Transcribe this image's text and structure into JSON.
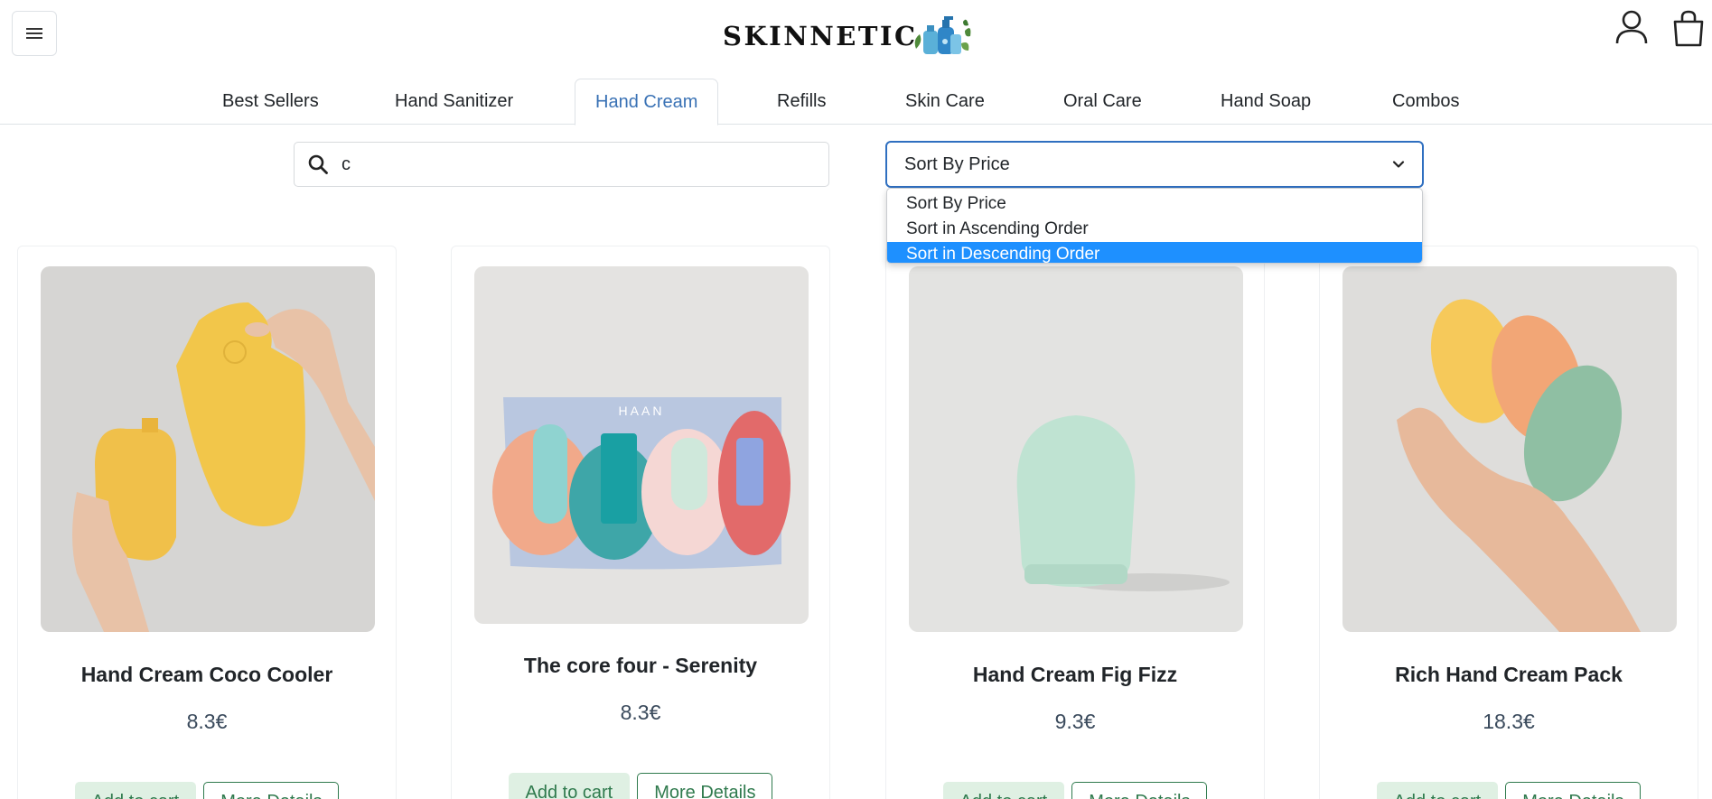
{
  "header": {
    "logo_text": "SKINNETIC",
    "menu_icon": "hamburger-icon",
    "user_icon": "user-icon",
    "cart_icon": "shopping-bag-icon"
  },
  "nav": {
    "tabs": [
      {
        "label": "Best Sellers"
      },
      {
        "label": "Hand Sanitizer"
      },
      {
        "label": "Hand Cream",
        "active": true
      },
      {
        "label": "Refills"
      },
      {
        "label": "Skin Care"
      },
      {
        "label": "Oral Care"
      },
      {
        "label": "Hand Soap"
      },
      {
        "label": "Combos"
      }
    ]
  },
  "search": {
    "value": "c",
    "icon": "search-icon"
  },
  "sort": {
    "selected": "Sort By Price",
    "options": [
      "Sort By Price",
      "Sort in Ascending Order",
      "Sort in Descending Order"
    ],
    "highlighted": "Sort in Descending Order"
  },
  "products": [
    {
      "name": "Hand Cream Coco Cooler",
      "price": "8.3€",
      "add_label": "Add to cart",
      "details_label": "More Details"
    },
    {
      "name": "The core four - Serenity",
      "price": "8.3€",
      "add_label": "Add to cart",
      "details_label": "More Details"
    },
    {
      "name": "Hand Cream Fig Fizz",
      "price": "9.3€",
      "add_label": "Add to cart",
      "details_label": "More Details"
    },
    {
      "name": "Rich Hand Cream Pack",
      "price": "18.3€",
      "add_label": "Add to cart",
      "details_label": "More Details"
    }
  ],
  "colors": {
    "accent_blue": "#2f6fc0",
    "tab_active": "#3a72b5",
    "highlight": "#1e90ff",
    "button_green": "#2f7a4d",
    "button_fill": "#dff0e3"
  }
}
